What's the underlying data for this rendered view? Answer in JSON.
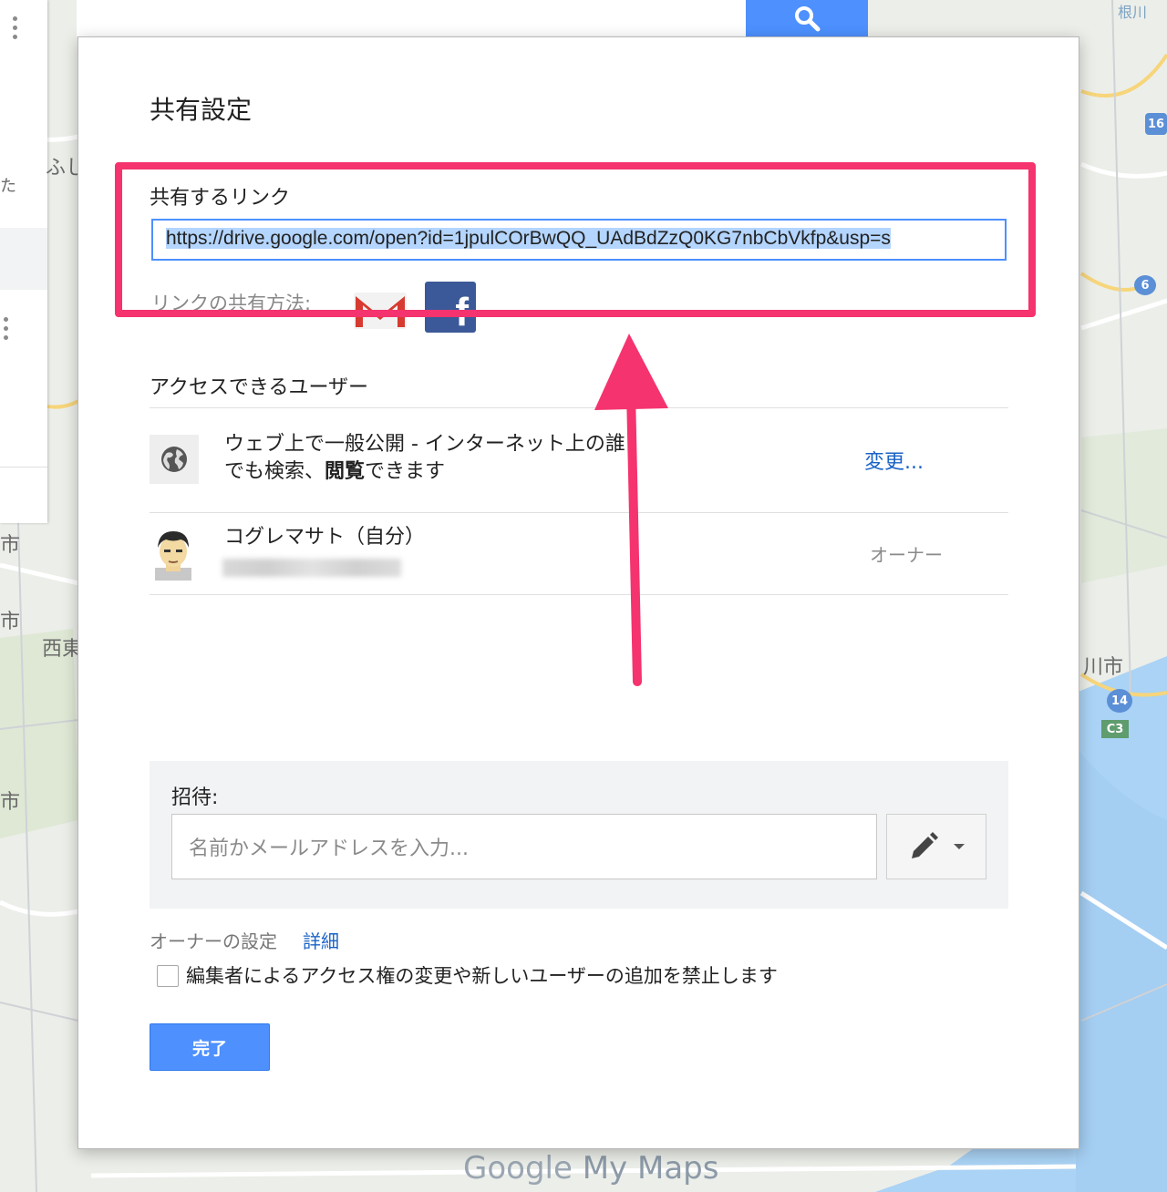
{
  "map": {
    "labels": [
      "市",
      "市",
      "市",
      "西東",
      "川市",
      "ふし",
      "た",
      "根川"
    ],
    "shields": [
      "16",
      "6",
      "14",
      "C3"
    ],
    "branding_google": "Google",
    "branding_product": "My Maps"
  },
  "search": {
    "icon": "search-icon"
  },
  "dialog": {
    "title": "共有設定",
    "share_link_label": "共有するリンク",
    "share_link_value": "https://drive.google.com/open?id=1jpulCOrBwQQ_UAdBdZzQ0KG7nbCbVkfp&usp=s",
    "share_via_label": "リンクの共有方法:",
    "share_icons": [
      "gmail-icon",
      "facebook-icon"
    ],
    "access_label": "アクセスできるユーザー",
    "public_row": {
      "line1": "ウェブ上で一般公開 - インターネット上の誰",
      "line2_prefix": "でも検索、",
      "line2_bold": "閲覧",
      "line2_suffix": "できます",
      "change_link": "変更..."
    },
    "owner_row": {
      "name": "コグレマサト（自分）",
      "role": "オーナー"
    },
    "invite": {
      "label": "招待:",
      "placeholder": "名前かメールアドレスを入力...",
      "permission_icon": "pencil-icon"
    },
    "owner_settings_label": "オーナーの設定",
    "owner_settings_link": "詳細",
    "checkbox_label": "編集者によるアクセス権の変更や新しいユーザーの追加を禁止します",
    "checkbox_checked": false,
    "done_button": "完了"
  },
  "colors": {
    "accent": "#4d90fe",
    "link": "#1a63c6",
    "annotation": "#f5336e",
    "facebook": "#3b5998"
  }
}
